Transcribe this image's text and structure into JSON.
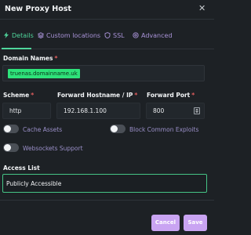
{
  "header": {
    "title": "New Proxy Host"
  },
  "tabs": [
    {
      "label": "Details",
      "icon": "lightning-icon"
    },
    {
      "label": "Custom locations",
      "icon": "layers-icon"
    },
    {
      "label": "SSL",
      "icon": "shield-icon"
    },
    {
      "label": "Advanced",
      "icon": "gear-icon"
    }
  ],
  "domain": {
    "label": "Domain Names",
    "required": "*",
    "chips": [
      "truenas.domainname.uk"
    ]
  },
  "forward": {
    "scheme_label": "Scheme",
    "scheme_value": "http",
    "host_label": "Forward Hostname / IP",
    "host_value": "192.168.1.100",
    "port_label": "Forward Port",
    "port_value": "800",
    "required": "*"
  },
  "toggles": [
    {
      "label": "Cache Assets",
      "on": false
    },
    {
      "label": "Block Common Exploits",
      "on": false
    },
    {
      "label": "Websockets Support",
      "on": false
    }
  ],
  "access": {
    "label": "Access List",
    "value": "Publicly Accessible"
  },
  "footer": {
    "cancel": "Cancel",
    "save": "Save"
  },
  "colors": {
    "accent": "#4fd69c",
    "tab": "#a993d8",
    "button": "#c9a4f2",
    "chip": "#2ee27a",
    "required": "#e05d5d"
  }
}
